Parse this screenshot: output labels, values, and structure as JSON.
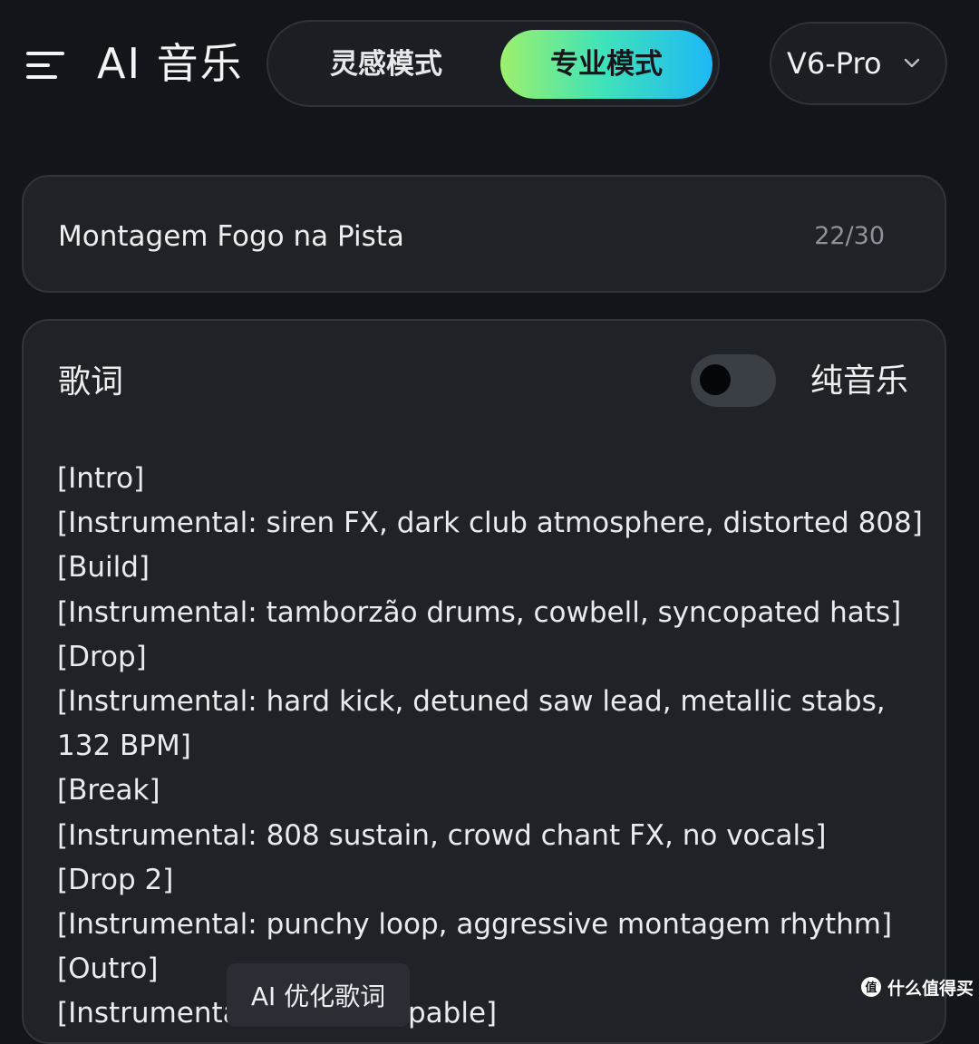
{
  "header": {
    "app_title": "AI 音乐",
    "mode_tabs": [
      {
        "label": "灵感模式",
        "active": false
      },
      {
        "label": "专业模式",
        "active": true
      }
    ],
    "model_select": {
      "value": "V6-Pro"
    }
  },
  "title_card": {
    "song_title": "Montagem Fogo na Pista",
    "char_count": "22/30"
  },
  "lyrics": {
    "heading": "歌词",
    "pure_music_label": "纯音乐",
    "pure_music_enabled": false,
    "lines": [
      "[Intro]",
      "[Instrumental: siren FX, dark club atmosphere, distorted 808]",
      "[Build]",
      "[Instrumental: tamborzão drums, cowbell, syncopated hats]",
      "[Drop]",
      "[Instrumental: hard kick, detuned saw lead, metallic stabs,",
      "132 BPM]",
      "[Break]",
      "[Instrumental: 808 sustain, crowd chant FX, no vocals]",
      "[Drop 2]",
      "[Instrumental: punchy loop, aggressive montagem rhythm]",
      "[Outro]",
      "[Instrumental: ... out, loopable]"
    ]
  },
  "ai_optimize_button": {
    "label": "AI 优化歌词"
  },
  "watermark": {
    "text": "什么值得买",
    "logo_glyph": "值"
  },
  "colors": {
    "background": "#121519",
    "card": "#1f2227",
    "accent_gradient_start": "#9df06c",
    "accent_gradient_mid": "#3fe3b9",
    "accent_gradient_end": "#1db8f6"
  }
}
